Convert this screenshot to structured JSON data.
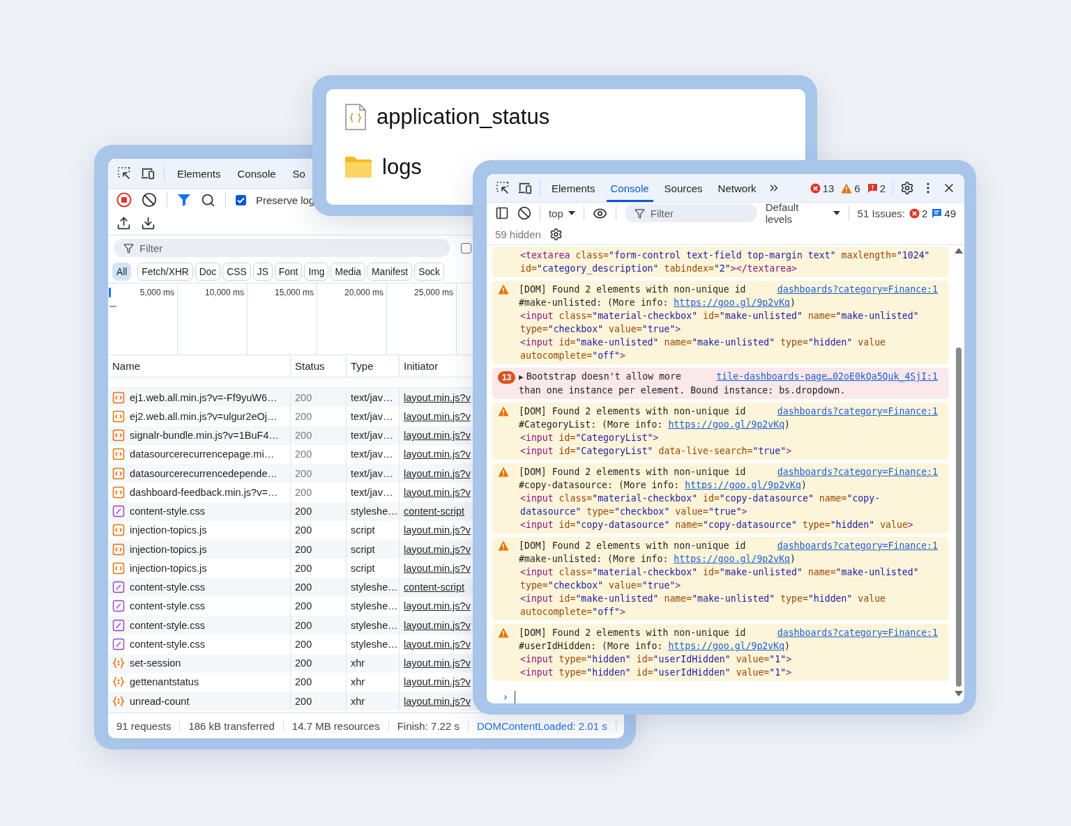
{
  "network_panel": {
    "tabs": [
      {
        "label": "Elements",
        "selected": false
      },
      {
        "label": "Console",
        "selected": false
      },
      {
        "label": "So",
        "selected": false
      }
    ],
    "preserve_log": {
      "label": "Preserve log",
      "checked": true
    },
    "filter": {
      "placeholder": "Filter"
    },
    "invert_checkbox": {
      "checked": false
    },
    "type_filters": [
      {
        "label": "All",
        "selected": true
      },
      {
        "label": "Fetch/XHR",
        "selected": false
      },
      {
        "label": "Doc",
        "selected": false
      },
      {
        "label": "CSS",
        "selected": false
      },
      {
        "label": "JS",
        "selected": false
      },
      {
        "label": "Font",
        "selected": false
      },
      {
        "label": "Img",
        "selected": false
      },
      {
        "label": "Media",
        "selected": false
      },
      {
        "label": "Manifest",
        "selected": false
      },
      {
        "label": "Sock",
        "selected": false
      }
    ],
    "timeline_ticks": [
      "5,000 ms",
      "10,000 ms",
      "15,000 ms",
      "20,000 ms",
      "25,000 ms"
    ],
    "columns": [
      "Name",
      "Status",
      "Type",
      "Initiator"
    ],
    "rows": [
      {
        "kind": "script",
        "name": "ej1.web.all.min.js?v=-Ff9yuW6…",
        "status": "200",
        "status_dimmed": true,
        "type": "text/jav…",
        "initiator": "layout.min.js?v"
      },
      {
        "kind": "script",
        "name": "ej2.web.all.min.js?v=ulgur2eOj…",
        "status": "200",
        "status_dimmed": true,
        "type": "text/jav…",
        "initiator": "layout.min.js?v"
      },
      {
        "kind": "script",
        "name": "signalr-bundle.min.js?v=1BuF4…",
        "status": "200",
        "status_dimmed": true,
        "type": "text/jav…",
        "initiator": "layout.min.js?v"
      },
      {
        "kind": "script",
        "name": "datasourcerecurrencepage.mi…",
        "status": "200",
        "status_dimmed": true,
        "type": "text/jav…",
        "initiator": "layout.min.js?v"
      },
      {
        "kind": "script",
        "name": "datasourcerecurrencedepende…",
        "status": "200",
        "status_dimmed": true,
        "type": "text/jav…",
        "initiator": "layout.min.js?v"
      },
      {
        "kind": "script",
        "name": "dashboard-feedback.min.js?v=…",
        "status": "200",
        "status_dimmed": true,
        "type": "text/jav…",
        "initiator": "layout.min.js?v"
      },
      {
        "kind": "css",
        "name": "content-style.css",
        "status": "200",
        "status_dimmed": false,
        "type": "styleshe…",
        "initiator": "content-script"
      },
      {
        "kind": "script",
        "name": "injection-topics.js",
        "status": "200",
        "status_dimmed": false,
        "type": "script",
        "initiator": "layout.min.js?v"
      },
      {
        "kind": "script",
        "name": "injection-topics.js",
        "status": "200",
        "status_dimmed": false,
        "type": "script",
        "initiator": "layout.min.js?v"
      },
      {
        "kind": "script",
        "name": "injection-topics.js",
        "status": "200",
        "status_dimmed": false,
        "type": "script",
        "initiator": "layout.min.js?v"
      },
      {
        "kind": "css",
        "name": "content-style.css",
        "status": "200",
        "status_dimmed": false,
        "type": "styleshe…",
        "initiator": "content-script"
      },
      {
        "kind": "css",
        "name": "content-style.css",
        "status": "200",
        "status_dimmed": false,
        "type": "styleshe…",
        "initiator": "layout.min.js?v"
      },
      {
        "kind": "css",
        "name": "content-style.css",
        "status": "200",
        "status_dimmed": false,
        "type": "styleshe…",
        "initiator": "layout.min.js?v"
      },
      {
        "kind": "css",
        "name": "content-style.css",
        "status": "200",
        "status_dimmed": false,
        "type": "styleshe…",
        "initiator": "layout.min.js?v"
      },
      {
        "kind": "xhr",
        "name": "set-session",
        "status": "200",
        "status_dimmed": false,
        "type": "xhr",
        "initiator": "layout.min.js?v"
      },
      {
        "kind": "xhr",
        "name": "gettenantstatus",
        "status": "200",
        "status_dimmed": false,
        "type": "xhr",
        "initiator": "layout.min.js?v"
      },
      {
        "kind": "xhr",
        "name": "unread-count",
        "status": "200",
        "status_dimmed": false,
        "type": "xhr",
        "initiator": "layout.min.js?v"
      }
    ],
    "status_bar": [
      {
        "kind": "plain",
        "text": "91 requests"
      },
      {
        "kind": "plain",
        "text": "186 kB transferred"
      },
      {
        "kind": "plain",
        "text": "14.7 MB resources"
      },
      {
        "kind": "plain",
        "text": "Finish: 7.22 s"
      },
      {
        "kind": "load",
        "text": "DOMContentLoaded: 2.01 s"
      }
    ]
  },
  "file_list": {
    "items": [
      {
        "kind": "json",
        "name": "application_status"
      },
      {
        "kind": "folder",
        "name": "logs"
      }
    ]
  },
  "console_panel": {
    "tabs": [
      {
        "label": "Elements",
        "selected": false
      },
      {
        "label": "Console",
        "selected": true
      },
      {
        "label": "Sources",
        "selected": false
      },
      {
        "label": "Network",
        "selected": false
      }
    ],
    "counts": [
      {
        "kind": "error",
        "count": "13"
      },
      {
        "kind": "warning",
        "count": "6"
      },
      {
        "kind": "issue",
        "count": "2"
      }
    ],
    "context": "top",
    "filter": {
      "placeholder": "Filter"
    },
    "levels": "Default levels",
    "issues_label": "51 Issues:",
    "issue_counts": [
      {
        "kind": "error",
        "count": "2"
      },
      {
        "kind": "info",
        "count": "49"
      }
    ],
    "hidden": "59 hidden",
    "messages": [
      {
        "kind": "warning",
        "code": [
          "<textarea class=\"form-control text-field top-margin text\" maxlength=\"1024\" id=\"category_description\" tabindex=\"2\"></textarea>"
        ]
      },
      {
        "kind": "warning",
        "text": "[DOM] Found 2 elements with non-unique id",
        "detail": "#make-unlisted: (More info: ",
        "info_link": "https://goo.gl/9p2vKq",
        "text_end": ")",
        "source": "dashboards?category=Finance:1",
        "code": [
          "<input class=\"material-checkbox\" id=\"make-unlisted\" name=\"make-unlisted\" type=\"checkbox\" value=\"true\">",
          "<input id=\"make-unlisted\" name=\"make-unlisted\" type=\"hidden\" value autocomplete=\"off\">"
        ]
      },
      {
        "kind": "error",
        "repeat_count": "13",
        "expander": "▶",
        "text": "Bootstrap doesn't allow more",
        "detail": "than one instance per element. Bound instance: bs.dropdown.",
        "source": "tile-dashboards-page…02oE0kQa5Quk_4SjI:1"
      },
      {
        "kind": "warning",
        "text": "[DOM] Found 2 elements with non-unique id",
        "detail": "#CategoryList: (More info: ",
        "info_link": "https://goo.gl/9p2vKq",
        "text_end": ")",
        "source": "dashboards?category=Finance:1",
        "code": [
          "<input id=\"CategoryList\">",
          "<input id=\"CategoryList\" data-live-search=\"true\">"
        ]
      },
      {
        "kind": "warning",
        "text": "[DOM] Found 2 elements with non-unique id",
        "detail": "#copy-datasource: (More info: ",
        "info_link": "https://goo.gl/9p2vKq",
        "text_end": ")",
        "source": "dashboards?category=Finance:1",
        "code": [
          "<input class=\"material-checkbox\" id=\"copy-datasource\" name=\"copy-datasource\" type=\"checkbox\" value=\"true\">",
          "<input id=\"copy-datasource\" name=\"copy-datasource\" type=\"hidden\" value>"
        ]
      },
      {
        "kind": "warning",
        "text": "[DOM] Found 2 elements with non-unique id",
        "detail": "#make-unlisted: (More info: ",
        "info_link": "https://goo.gl/9p2vKq",
        "text_end": ")",
        "source": "dashboards?category=Finance:1",
        "code": [
          "<input class=\"material-checkbox\" id=\"make-unlisted\" name=\"make-unlisted\" type=\"checkbox\" value=\"true\">",
          "<input id=\"make-unlisted\" name=\"make-unlisted\" type=\"hidden\" value autocomplete=\"off\">"
        ]
      },
      {
        "kind": "warning",
        "text": "[DOM] Found 2 elements with non-unique id",
        "detail": "#userIdHidden: (More info: ",
        "info_link": "https://goo.gl/9p2vKq",
        "text_end": ")",
        "source": "dashboards?category=Finance:1",
        "code": [
          "<input type=\"hidden\" id=\"userIdHidden\" value=\"1\">",
          "<input type=\"hidden\" id=\"userIdHidden\" value=\"1\">"
        ]
      }
    ],
    "prompt": "›"
  }
}
